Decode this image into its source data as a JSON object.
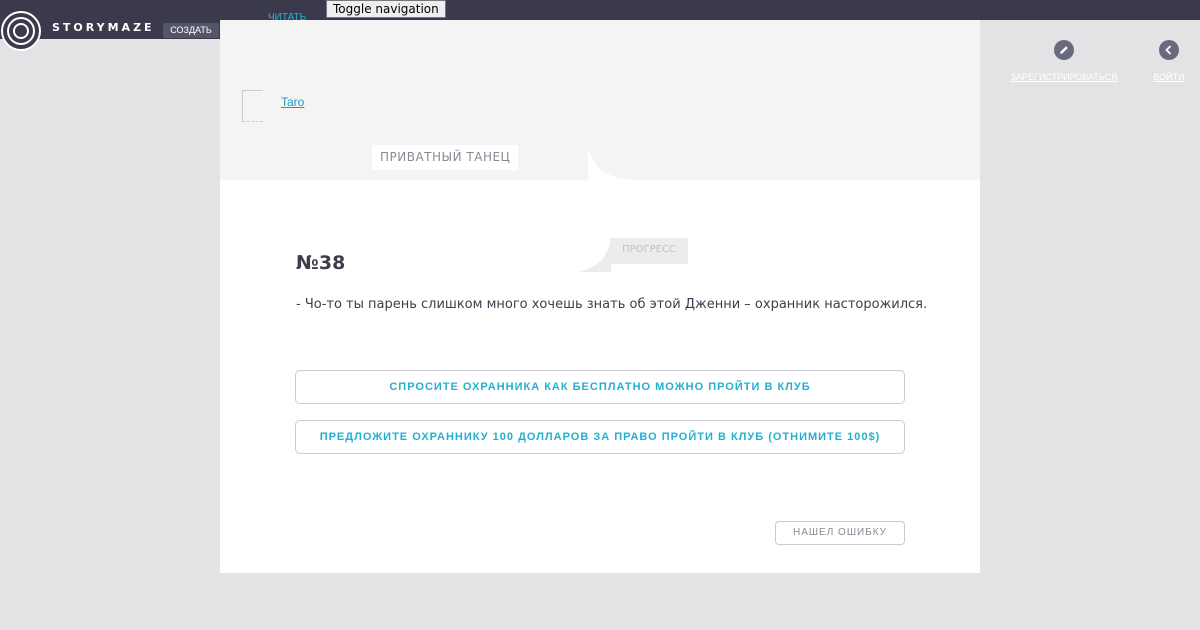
{
  "header": {
    "brand_name": "STORYMAZE",
    "create_label": "СОЗДАТЬ",
    "toggle_nav_label": "Toggle navigation",
    "hidden_link_fragment": "ЧИТАТЬ",
    "register_label": "ЗАРЕГИСТРИРОВАТЬСЯ",
    "login_label": "ВОЙТИ"
  },
  "story": {
    "author": "Taro",
    "title": "ПРИВАТНЫЙ ТАНЕЦ",
    "progress_label": "ПРОГРЕСС"
  },
  "step": {
    "number": "№38",
    "text": "- Чо-то ты парень слишком много хочешь знать об этой Дженни – охранник насторожился."
  },
  "choices": [
    {
      "label": "СПРОСИТЕ ОХРАННИКА КАК БЕСПЛАТНО МОЖНО ПРОЙТИ В КЛУБ"
    },
    {
      "label": "ПРЕДЛОЖИТЕ ОХРАННИКУ 100 ДОЛЛАРОВ ЗА ПРАВО ПРОЙТИ В КЛУБ (ОТНИМИТЕ 100$)"
    }
  ],
  "report_error_label": "НАШЕЛ ОШИБКУ",
  "colors": {
    "accent": "#23b0d0",
    "header_bg": "#3a3a4c",
    "page_bg": "#e3e3e5",
    "text": "#3d3d4d"
  },
  "icons": {
    "logo": "spiral-logo-icon",
    "register": "pencil-icon",
    "login": "chevron-left-icon"
  }
}
